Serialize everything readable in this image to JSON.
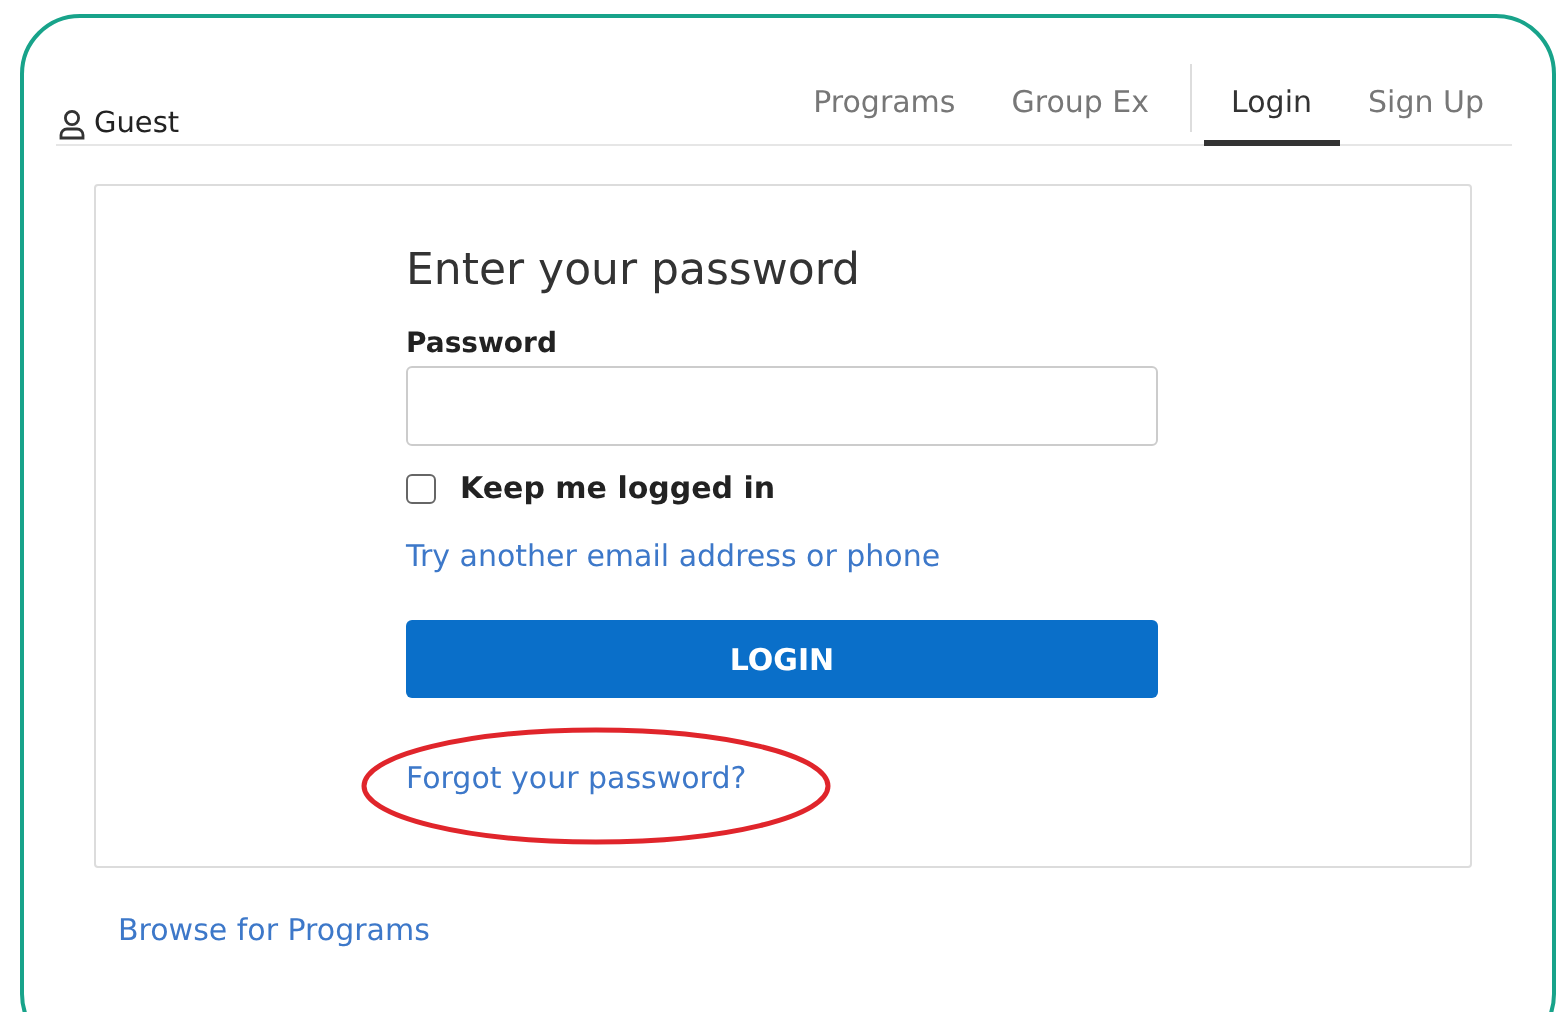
{
  "header": {
    "user": "Guest",
    "nav": [
      {
        "label": "Programs",
        "selected": false
      },
      {
        "label": "Group Ex",
        "selected": false
      },
      {
        "label": "Login",
        "selected": true
      },
      {
        "label": "Sign Up",
        "selected": false
      }
    ]
  },
  "form": {
    "title": "Enter your password",
    "password_label": "Password",
    "keep_logged_in": {
      "label": "Keep me logged in",
      "checked": false
    },
    "alt_link": "Try another email address or phone",
    "submit": "LOGIN",
    "forgot_link": "Forgot your password?",
    "forgot_highlighted": true
  },
  "footer_link": "Browse for Programs"
}
